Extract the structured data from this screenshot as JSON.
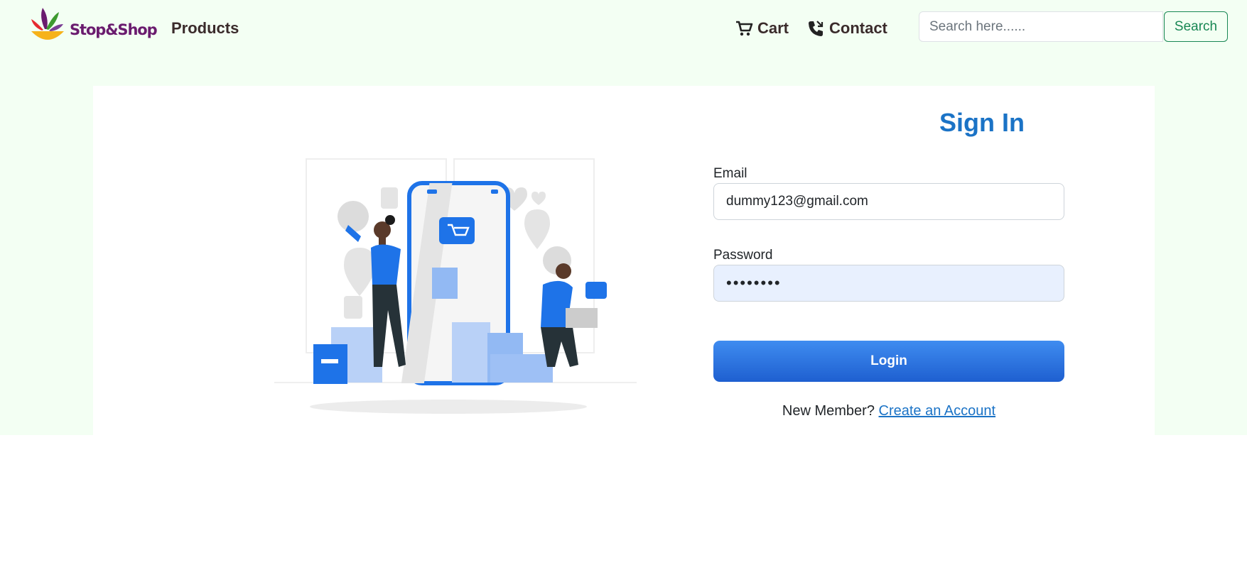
{
  "header": {
    "brand_name": "Stop&Shop",
    "nav": {
      "products_label": "Products",
      "cart_label": "Cart",
      "contact_label": "Contact"
    },
    "search": {
      "placeholder": "Search here......",
      "value": "",
      "button_label": "Search"
    }
  },
  "signin": {
    "title": "Sign In",
    "email_label": "Email",
    "email_value": "dummy123@gmail.com",
    "password_label": "Password",
    "password_value": "••••••••",
    "login_label": "Login",
    "new_member_text": "New Member?",
    "create_account_label": "Create an Account"
  },
  "colors": {
    "page_background": "#f3fff3",
    "accent_blue": "#1b73c6",
    "login_button": "#2a6fdf",
    "search_green": "#198754",
    "password_autofill_bg": "#e8f0fe"
  },
  "icons": [
    "cart-icon",
    "phone-icon",
    "brand-logo",
    "shopping-illustration"
  ]
}
